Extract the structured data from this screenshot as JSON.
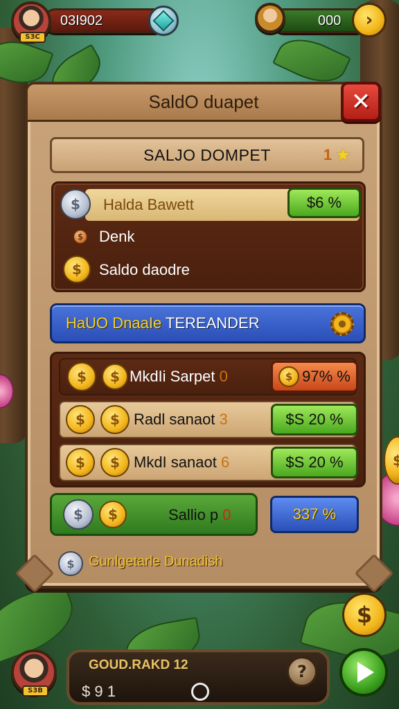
{
  "hud": {
    "player_currency": "03I902",
    "right_currency": "000",
    "avatar_badge": "S3C",
    "bottom_avatar_badge": "S3B"
  },
  "panel": {
    "title": "SaldO duapet",
    "subheader": "SALJO DOMPET",
    "subheader_badge": "1",
    "highlight_row": {
      "label": "Halda Bawett",
      "value": "$6 %"
    },
    "row_denk": "Denk",
    "row_saldo": "Saldo daodre",
    "banner_yellow": "HaUO DnaaIe",
    "banner_white": "TEREANDER",
    "list": [
      {
        "label": "MkdIi Sarpet",
        "num": "0",
        "value": "97% %",
        "style": "orange"
      },
      {
        "label": "Radl sanaot",
        "num": "3",
        "value": "$S 20 %",
        "style": "green"
      },
      {
        "label": "MkdI sanaot",
        "num": "6",
        "value": "$S 20 %",
        "style": "green"
      }
    ],
    "green_bar_label": "Sallio p",
    "green_bar_num": "0",
    "blue_value": "337 %",
    "footer_note": "Gunlgetarle Dunadish"
  },
  "bottom": {
    "title": "GOUD.RAKD 12",
    "value": "$ 9 1",
    "help": "?"
  },
  "colors": {
    "accent_gold": "#f2b51a",
    "panel_wood": "#b58d64",
    "close_red": "#b21f18",
    "banner_blue": "#2a4fb8",
    "btn_green": "#4aa81e"
  },
  "icons": [
    "gem-icon",
    "gold-coin-icon",
    "silver-coin-icon",
    "close-icon",
    "gear-icon",
    "star-icon",
    "help-icon",
    "play-icon"
  ]
}
